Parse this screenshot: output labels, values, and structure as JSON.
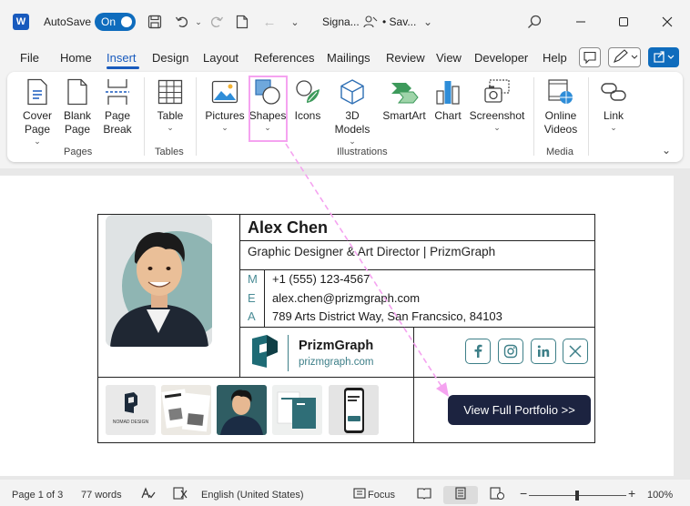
{
  "titlebar": {
    "app_letter": "W",
    "autosave_label": "AutoSave",
    "autosave_state": "On",
    "doc_title": "Signa...",
    "saved_status": "• Sav..."
  },
  "menu": {
    "tabs": [
      "File",
      "Home",
      "Insert",
      "Design",
      "Layout",
      "References",
      "Mailings",
      "Review",
      "View",
      "Developer",
      "Help"
    ],
    "active_tab": "Insert"
  },
  "ribbon": {
    "items": [
      {
        "label": "Cover\nPage",
        "chevron": "⌄"
      },
      {
        "label": "Blank\nPage",
        "chevron": ""
      },
      {
        "label": "Page\nBreak",
        "chevron": ""
      },
      {
        "label": "Table",
        "chevron": "⌄"
      },
      {
        "label": "Pictures",
        "chevron": "⌄"
      },
      {
        "label": "Shapes",
        "chevron": "⌄"
      },
      {
        "label": "Icons",
        "chevron": ""
      },
      {
        "label": "3D\nModels",
        "chevron": "⌄"
      },
      {
        "label": "SmartArt",
        "chevron": ""
      },
      {
        "label": "Chart",
        "chevron": ""
      },
      {
        "label": "Screenshot",
        "chevron": "⌄"
      },
      {
        "label": "Online\nVideos",
        "chevron": ""
      },
      {
        "label": "Link",
        "chevron": "⌄"
      }
    ],
    "groups": [
      "Pages",
      "Tables",
      "Illustrations",
      "Media"
    ]
  },
  "signature": {
    "name": "Alex Chen",
    "role": "Graphic Designer & Art Director | PrizmGraph",
    "contacts": [
      {
        "letter": "M",
        "value": "+1 (555) 123-4567"
      },
      {
        "letter": "E",
        "value": "alex.chen@prizmgraph.com"
      },
      {
        "letter": "A",
        "value": "789 Arts District Way, San Francsico, 84103"
      }
    ],
    "brand_name": "PrizmGraph",
    "brand_url": "prizmgraph.com",
    "social": [
      "f",
      "ig",
      "in",
      "X"
    ],
    "portfolio_button": "View Full Portfolio >>",
    "thumb1_caption": "NOMAD DESIGN"
  },
  "status": {
    "page": "Page 1 of 3",
    "words": "77 words",
    "language": "English (United States)",
    "focus": "Focus",
    "zoom": "100%"
  },
  "colors": {
    "accent": "#185abd",
    "teal": "#3d7f88",
    "button_dark": "#1c2340",
    "highlight": "#f5a3f0"
  }
}
